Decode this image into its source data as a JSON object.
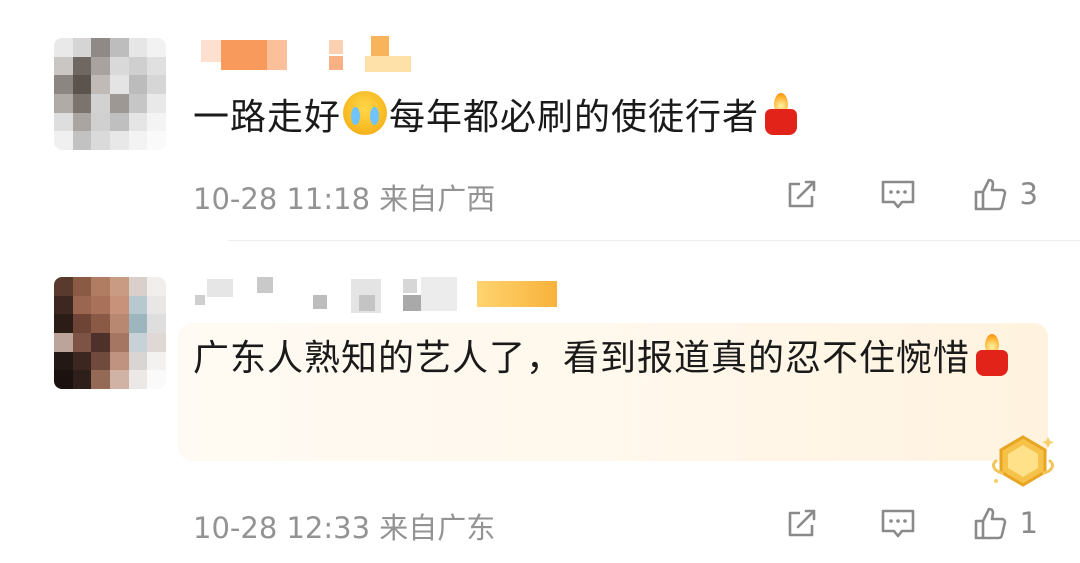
{
  "comments": [
    {
      "text_before_emoji": "一路走好",
      "text_after_emoji": "每年都必刷的使徒行者",
      "timestamp": "10-28 11:18",
      "location": "来自广西",
      "like_count": "3",
      "icons": {
        "emoji": "loudly-crying-face-icon",
        "end": "candle-icon"
      }
    },
    {
      "text": "广东人熟知的艺人了，看到报道真的忍不住惋惜",
      "timestamp": "10-28 12:33",
      "location": "来自广东",
      "like_count": "1",
      "icons": {
        "end": "candle-icon",
        "badge": "gold-fan-badge-icon"
      }
    }
  ],
  "action_icons": [
    "share-icon",
    "comment-icon",
    "like-icon"
  ],
  "colors": {
    "meta_gray": "#939393",
    "candle_red": "#e2231a",
    "highlight_bg": "#fff7ea"
  }
}
